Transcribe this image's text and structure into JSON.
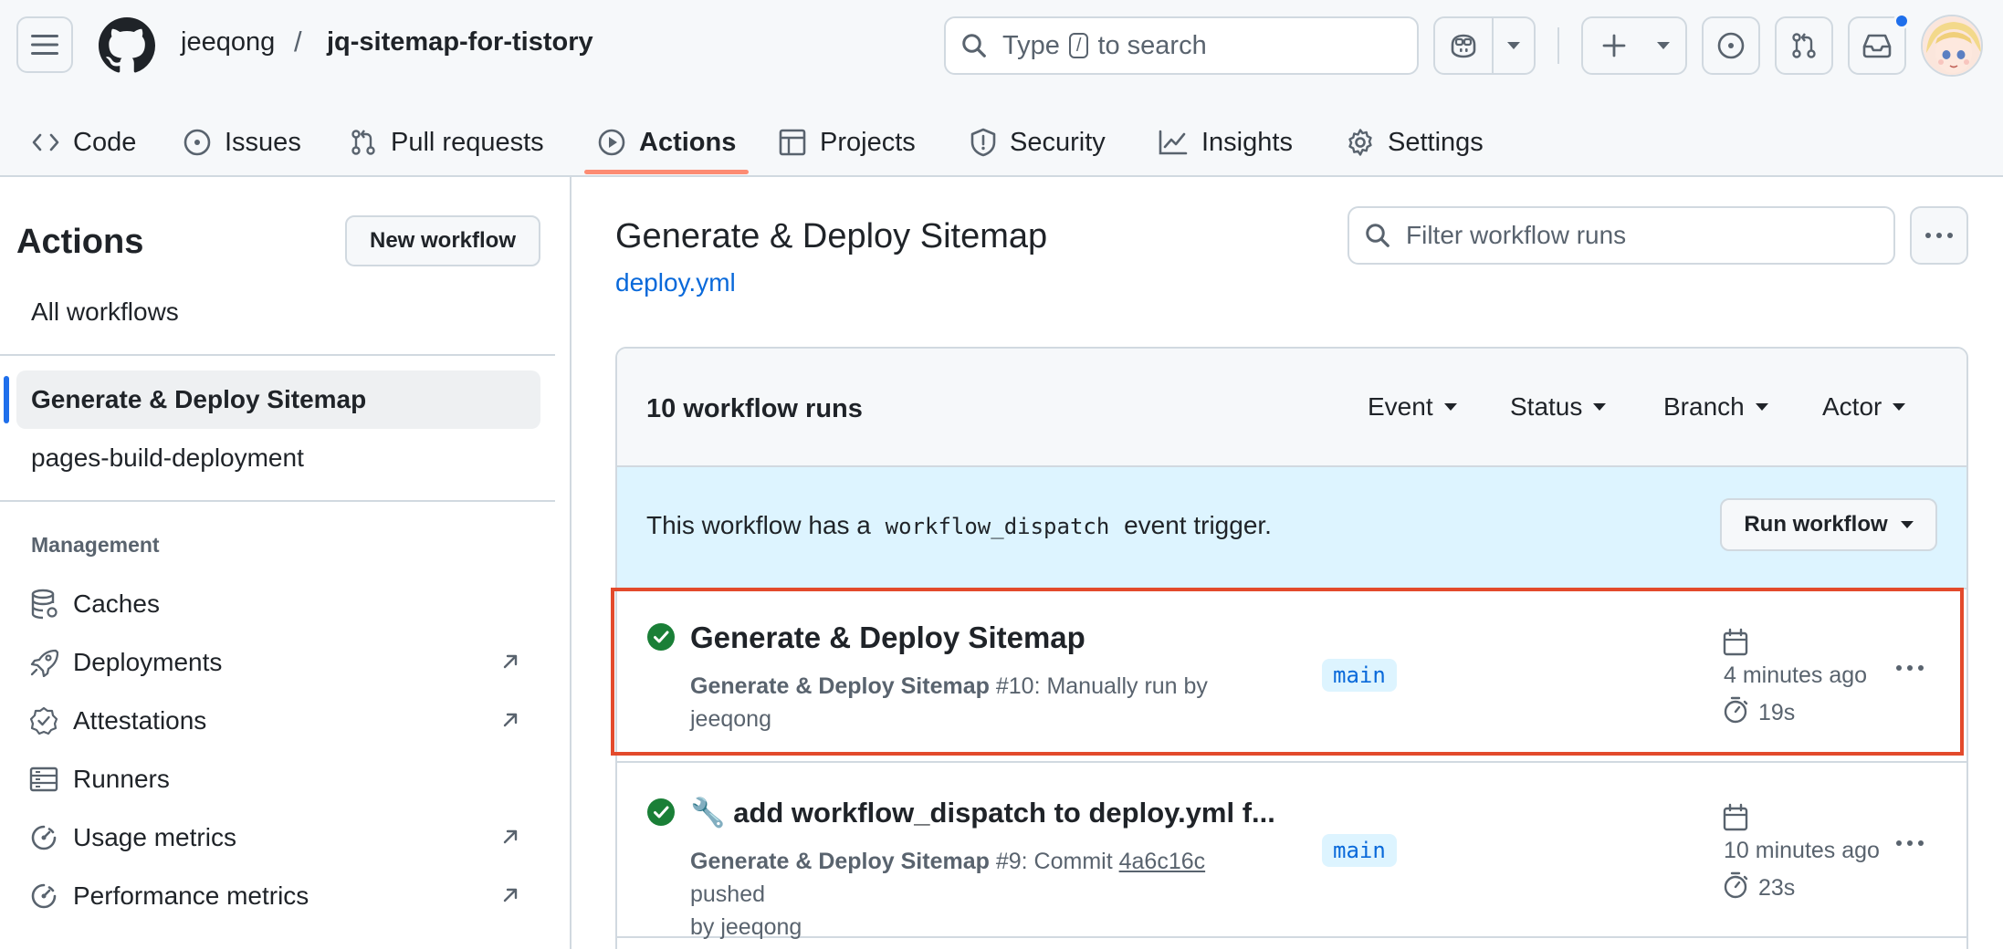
{
  "header": {
    "owner": "jeeqong",
    "separator": "/",
    "repo": "jq-sitemap-for-tistory",
    "search_placeholder_pre": "Type",
    "search_key": "/",
    "search_placeholder_post": "to search"
  },
  "tabs": [
    {
      "label": "Code",
      "icon": "code-icon"
    },
    {
      "label": "Issues",
      "icon": "issue-icon"
    },
    {
      "label": "Pull requests",
      "icon": "pull-request-icon"
    },
    {
      "label": "Actions",
      "icon": "play-icon",
      "active": true
    },
    {
      "label": "Projects",
      "icon": "table-icon"
    },
    {
      "label": "Security",
      "icon": "shield-icon"
    },
    {
      "label": "Insights",
      "icon": "graph-icon"
    },
    {
      "label": "Settings",
      "icon": "gear-icon"
    }
  ],
  "sidebar": {
    "title": "Actions",
    "new_workflow": "New workflow",
    "all_workflows": "All workflows",
    "workflows": [
      "Generate & Deploy Sitemap",
      "pages-build-deployment"
    ],
    "management_heading": "Management",
    "management": [
      {
        "label": "Caches",
        "icon": "database-icon",
        "external": false
      },
      {
        "label": "Deployments",
        "icon": "rocket-icon",
        "external": true
      },
      {
        "label": "Attestations",
        "icon": "verified-icon",
        "external": true
      },
      {
        "label": "Runners",
        "icon": "server-icon",
        "external": false
      },
      {
        "label": "Usage metrics",
        "icon": "meter-icon",
        "external": true
      },
      {
        "label": "Performance metrics",
        "icon": "meter-icon",
        "external": true
      }
    ]
  },
  "main": {
    "title": "Generate & Deploy Sitemap",
    "file": "deploy.yml",
    "filter_placeholder": "Filter workflow runs",
    "run_count": "10 workflow runs",
    "filters": [
      "Event",
      "Status",
      "Branch",
      "Actor"
    ],
    "info_pre": "This workflow has a",
    "info_code": "workflow_dispatch",
    "info_post": "event trigger.",
    "run_workflow": "Run workflow",
    "runs": [
      {
        "title": "Generate & Deploy Sitemap",
        "workflow": "Generate & Deploy Sitemap",
        "number": "#10",
        "desc_line1": ": Manually run by",
        "desc_line2": "jeeqong",
        "branch": "main",
        "when": "4 minutes ago",
        "duration": "19s",
        "status": "success"
      },
      {
        "title": "🔧 add workflow_dispatch to deploy.yml f...",
        "workflow": "Generate & Deploy Sitemap",
        "number": "#9",
        "desc_pre": ": Commit",
        "sha": "4a6c16c",
        "desc_post": "pushed",
        "desc_line2": "by jeeqong",
        "branch": "main",
        "when": "10 minutes ago",
        "duration": "23s",
        "status": "success"
      }
    ]
  },
  "colors": {
    "accent_underline": "#fd8c73",
    "link": "#0969da",
    "success": "#1a7f37",
    "highlight": "#e34a2c",
    "notification": "#1f6feb"
  }
}
